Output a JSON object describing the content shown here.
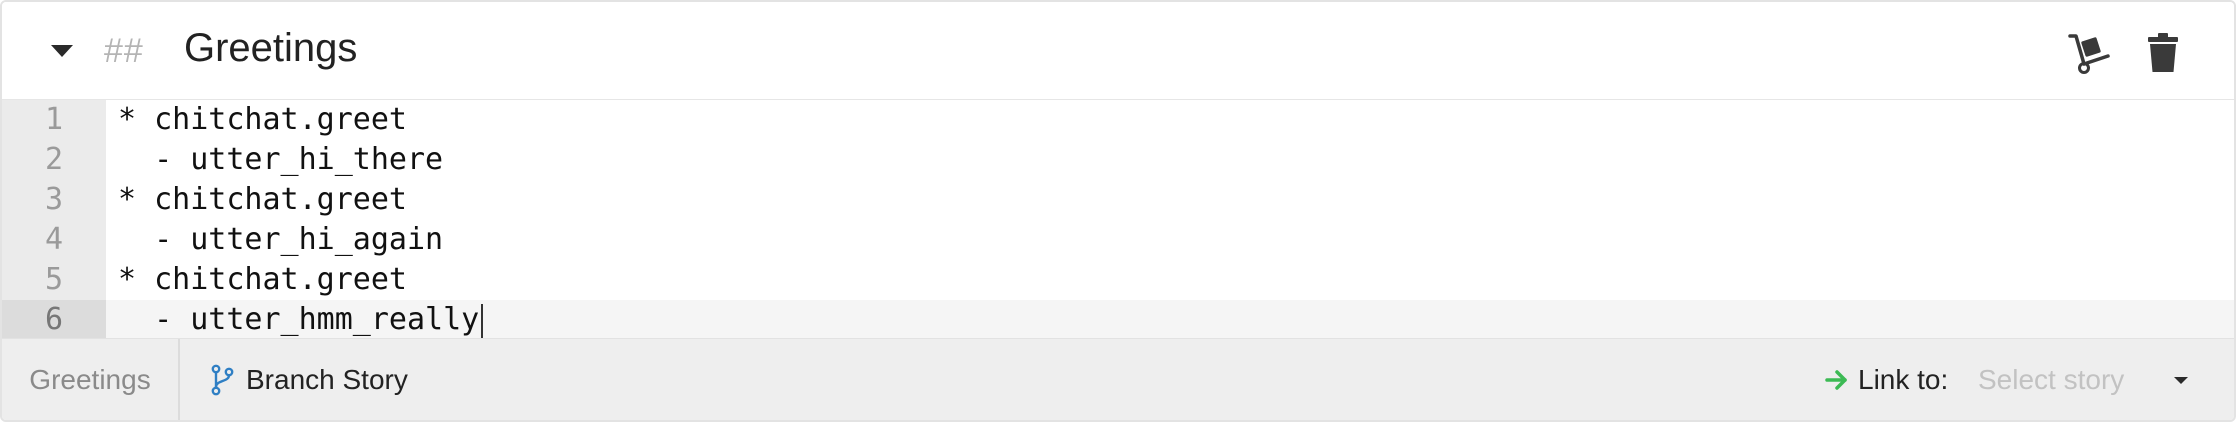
{
  "header": {
    "heading_marker": "##",
    "title": "Greetings",
    "icons": {
      "collapse": "caret-down-icon",
      "move": "dolly-icon",
      "delete": "trash-icon"
    }
  },
  "editor": {
    "lines": [
      {
        "number": "1",
        "text": "* chitchat.greet"
      },
      {
        "number": "2",
        "text": "  - utter_hi_there"
      },
      {
        "number": "3",
        "text": "* chitchat.greet"
      },
      {
        "number": "4",
        "text": "  - utter_hi_again"
      },
      {
        "number": "5",
        "text": "* chitchat.greet"
      },
      {
        "number": "6",
        "text": "  - utter_hmm_really"
      }
    ],
    "active_line": 6
  },
  "footer": {
    "story_name": "Greetings",
    "branch_label": "Branch Story",
    "link_label": "Link to:",
    "select_placeholder": "Select story",
    "icons": {
      "branch": "code-branch-icon",
      "link": "arrow-right-icon",
      "select": "caret-down-icon"
    }
  },
  "colors": {
    "branch_icon": "#2f7fc4",
    "link_arrow": "#3cba54",
    "gutter": "#ebebeb",
    "footer": "#eeeeee"
  }
}
